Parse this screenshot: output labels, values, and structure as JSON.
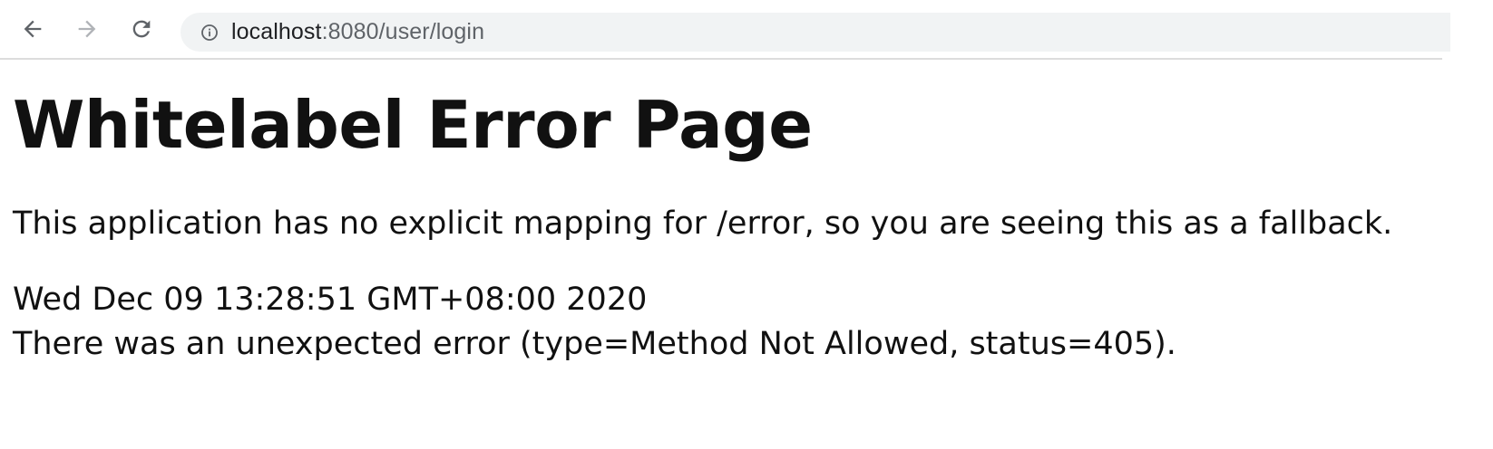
{
  "browser": {
    "url_host": "localhost",
    "url_rest": ":8080/user/login",
    "icons": {
      "back": "arrow-left-icon",
      "forward": "arrow-right-icon",
      "reload": "reload-icon",
      "site_info": "info-icon"
    }
  },
  "page": {
    "title": "Whitelabel Error Page",
    "message": "This application has no explicit mapping for /error, so you are seeing this as a fallback.",
    "timestamp": "Wed Dec 09 13:28:51 GMT+08:00 2020",
    "error_detail": "There was an unexpected error (type=Method Not Allowed, status=405)."
  },
  "colors": {
    "text": "#111111",
    "omnibox_bg": "#f1f3f4",
    "icon_gray": "#5f6368",
    "icon_disabled": "#b0b3b7"
  }
}
